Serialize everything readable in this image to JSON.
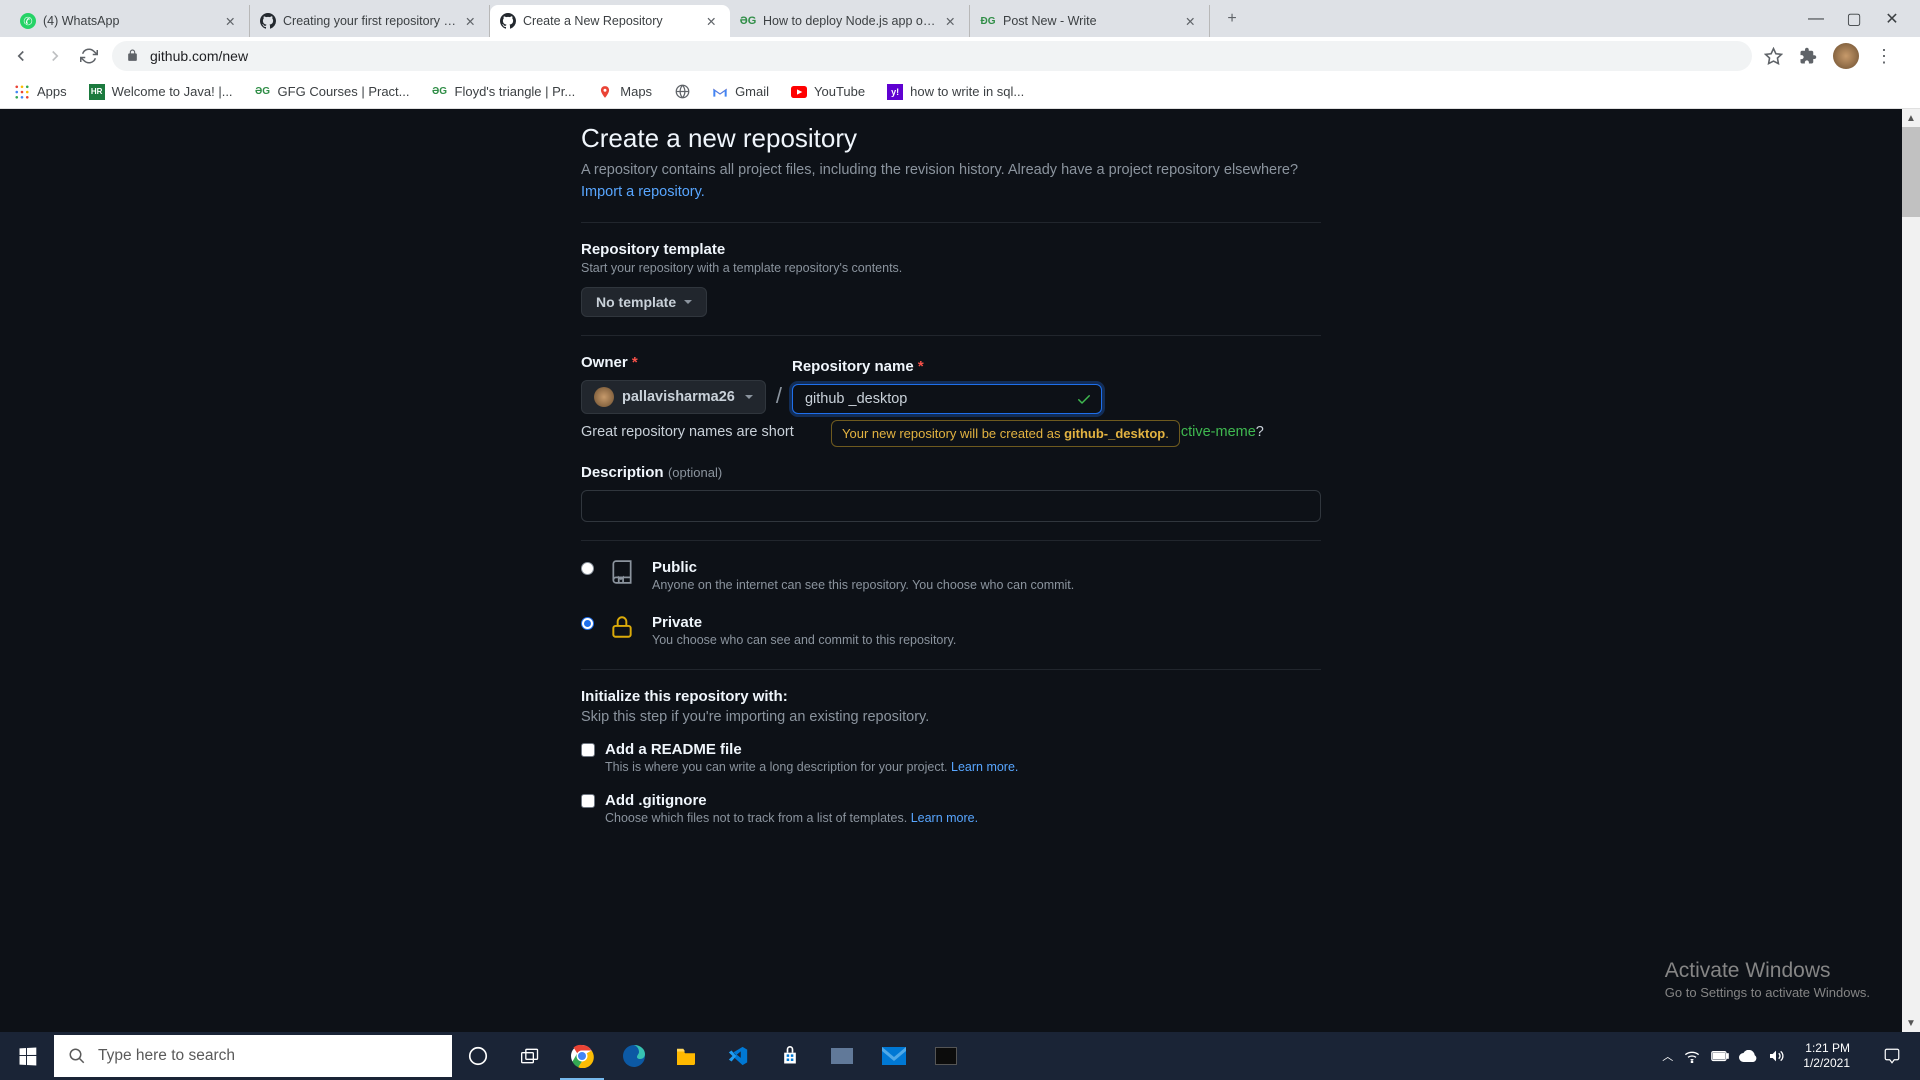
{
  "browser": {
    "tabs": [
      {
        "title": "(4) WhatsApp",
        "favicon_color": "#25D366"
      },
      {
        "title": "Creating your first repository usin",
        "favicon_color": "#24292f"
      },
      {
        "title": "Create a New Repository",
        "favicon_color": "#24292f",
        "active": true
      },
      {
        "title": "How to deploy Node.js app on H",
        "favicon_color": "#2f8d46"
      },
      {
        "title": "Post New - Write",
        "favicon_color": "#2f8d46"
      }
    ],
    "url": "github.com/new",
    "bookmarks": [
      {
        "label": "Apps"
      },
      {
        "label": "Welcome to Java! |..."
      },
      {
        "label": "GFG Courses | Pract..."
      },
      {
        "label": "Floyd's triangle | Pr..."
      },
      {
        "label": "Maps"
      },
      {
        "label": ""
      },
      {
        "label": "Gmail"
      },
      {
        "label": "YouTube"
      },
      {
        "label": "how to write in sql..."
      }
    ]
  },
  "page": {
    "title": "Create a new repository",
    "subtitle": "A repository contains all project files, including the revision history. Already have a project repository elsewhere? ",
    "import_link": "Import a repository.",
    "template_label": "Repository template",
    "template_help": "Start your repository with a template repository's contents.",
    "template_value": "No template",
    "owner_label": "Owner",
    "owner_value": "pallavisharma26",
    "reponame_label": "Repository name",
    "reponame_value": "github _desktop",
    "hint_prefix": "Great repository names are short",
    "tooltip_text": "Your new repository will be created as ",
    "tooltip_slug": "github-_desktop",
    "hint_suffix_meme": "ective-meme",
    "hint_q": "?",
    "desc_label": "Description",
    "desc_optional": "(optional)",
    "visibility": {
      "public_title": "Public",
      "public_desc": "Anyone on the internet can see this repository. You choose who can commit.",
      "private_title": "Private",
      "private_desc": "You choose who can see and commit to this repository."
    },
    "init_title": "Initialize this repository with:",
    "init_help": "Skip this step if you're importing an existing repository.",
    "readme_title": "Add a README file",
    "readme_desc": "This is where you can write a long description for your project. ",
    "learn_more": "Learn more.",
    "gitignore_title": "Add .gitignore",
    "gitignore_desc": "Choose which files not to track from a list of templates. "
  },
  "watermark": {
    "title": "Activate Windows",
    "sub": "Go to Settings to activate Windows."
  },
  "taskbar": {
    "search_placeholder": "Type here to search",
    "time": "1:21 PM",
    "date": "1/2/2021"
  }
}
